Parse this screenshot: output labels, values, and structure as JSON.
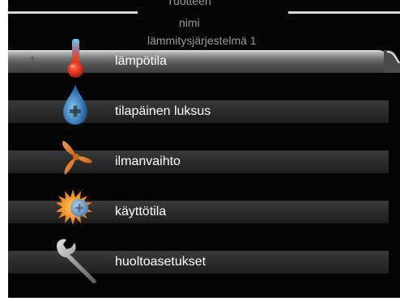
{
  "header": {
    "line1": "Tuotteen",
    "line2": "nimi",
    "line3": "lämmitysjärjestelmä 1"
  },
  "menu": {
    "selected_number": "1",
    "items": [
      {
        "label": "lämpötila",
        "icon": "thermometer-icon"
      },
      {
        "label": "tilapäinen luksus",
        "icon": "water-drop-icon"
      },
      {
        "label": "ilmanvaihto",
        "icon": "fan-icon"
      },
      {
        "label": "käyttötila",
        "icon": "sun-icon"
      },
      {
        "label": "huoltoasetukset",
        "icon": "wrench-icon"
      }
    ]
  },
  "colors": {
    "background": "#050505",
    "menu_bar": "#2a2a2a",
    "text": "#ffffff",
    "header_text": "#9a9a9a"
  }
}
